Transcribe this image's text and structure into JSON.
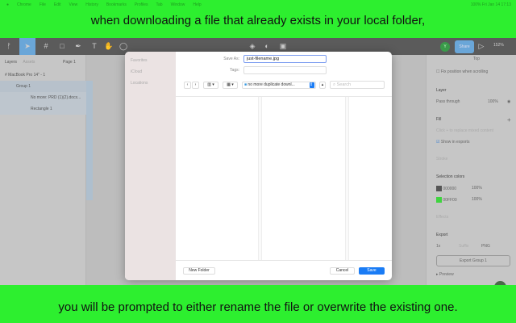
{
  "menubar": {
    "items": [
      "Chrome",
      "File",
      "Edit",
      "View",
      "History",
      "Bookmarks",
      "Profiles",
      "Tab",
      "Window",
      "Help"
    ],
    "status": "100%  Fri Jan 14  17:13"
  },
  "captions": {
    "top": "when downloading a file that already exists in your local folder,",
    "bottom": "you will be prompted to either rename the file or overwrite the existing one."
  },
  "toolbar": {
    "share": "Share",
    "avatar": "Y",
    "zoom": "152%"
  },
  "layers": {
    "tab_layers": "Layers",
    "tab_assets": "Assets",
    "page": "Page 1",
    "items": [
      "MacBook Pro 14\" - 1",
      "Group 1",
      "No more: PRD (1)(2).docx...",
      "Rectangle 1"
    ]
  },
  "right": {
    "constraint": "Top",
    "fix_position": "Fix position when scrolling",
    "layer": "Layer",
    "blend": "Pass through",
    "opacity": "100%",
    "fill": "Fill",
    "fill_hint": "Click + to replace mixed content",
    "show_exports": "Show in exports",
    "stroke": "Stroke",
    "selection_colors": "Selection colors",
    "colors": [
      {
        "hex": "000000",
        "opacity": "100%",
        "swatch": "#555555"
      },
      {
        "hex": "00FF00",
        "opacity": "100%",
        "swatch": "#3fd43f"
      }
    ],
    "effects": "Effects",
    "export": "Export",
    "scale": "1x",
    "suffix": "Suffix",
    "format": "PNG",
    "export_button": "Export Group 1",
    "preview": "Preview"
  },
  "dialog": {
    "sidebar": [
      "Favorites",
      "iCloud",
      "Locations"
    ],
    "save_as_label": "Save As:",
    "save_as_value": "just-filename.jpg",
    "tags_label": "Tags:",
    "location": "no more duplicate downl...",
    "search_placeholder": "Search",
    "new_folder": "New Folder",
    "cancel": "Cancel",
    "save": "Save"
  },
  "colors": {
    "caption_green": "#2def2f",
    "save_blue": "#1a7cf5"
  }
}
